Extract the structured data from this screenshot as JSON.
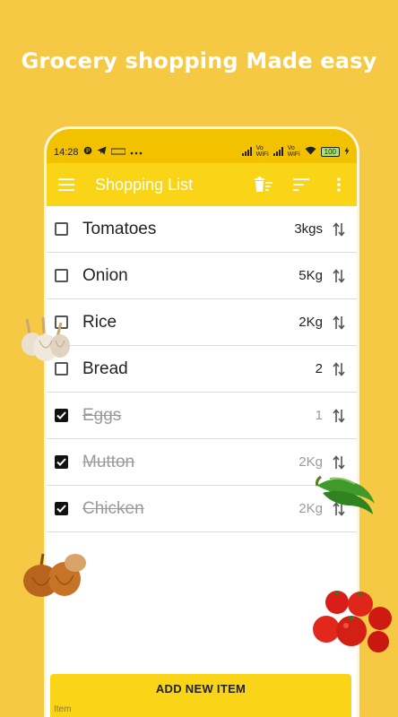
{
  "promo": {
    "title": "Grocery shopping Made easy"
  },
  "status_bar": {
    "time": "14:28",
    "volte1": "Vo\nWiFi",
    "volte2": "Vo\nWiFi",
    "battery": "100"
  },
  "toolbar": {
    "title": "Shopping List"
  },
  "items": [
    {
      "name": "Tomatoes",
      "qty": "3kgs",
      "checked": false
    },
    {
      "name": "Onion",
      "qty": "5Kg",
      "checked": false
    },
    {
      "name": "Rice",
      "qty": "2Kg",
      "checked": false
    },
    {
      "name": "Bread",
      "qty": "2",
      "checked": false
    },
    {
      "name": "Eggs",
      "qty": "1",
      "checked": true
    },
    {
      "name": "Mutton",
      "qty": "2Kg",
      "checked": true
    },
    {
      "name": "Chicken",
      "qty": "2Kg",
      "checked": true
    }
  ],
  "add_panel": {
    "button_label": "ADD NEW ITEM",
    "input_placeholder": "Item"
  },
  "colors": {
    "background": "#f6c945",
    "toolbar": "#f9d417",
    "status_bar": "#f2c200"
  }
}
